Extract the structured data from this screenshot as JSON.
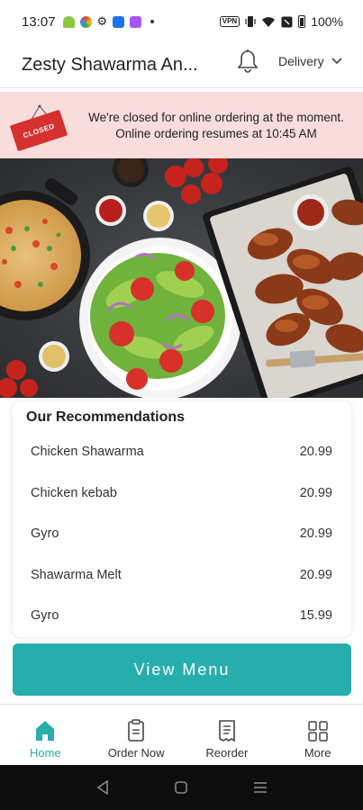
{
  "status_bar": {
    "time": "13:07",
    "vpn": "VPN",
    "battery": "100%"
  },
  "header": {
    "store_name": "Zesty Shawarma An...",
    "delivery_label": "Delivery",
    "icons": [
      "bell-icon",
      "chevron-down-icon"
    ]
  },
  "banner": {
    "sign_text": "CLOSED",
    "line1": "We're closed for online ordering at the moment.",
    "line2": "Online ordering resumes at 10:45 AM"
  },
  "recommendations": {
    "title": "Our Recommendations",
    "items": [
      {
        "name": "Chicken Shawarma",
        "price": "20.99"
      },
      {
        "name": "Chicken kebab",
        "price": "20.99"
      },
      {
        "name": "Gyro",
        "price": "20.99"
      },
      {
        "name": "Shawarma Melt",
        "price": "20.99"
      },
      {
        "name": "Gyro",
        "price": "15.99"
      }
    ]
  },
  "view_menu": {
    "label": "View Menu"
  },
  "bottom_nav": {
    "items": [
      {
        "label": "Home",
        "icon": "home-icon",
        "active": true
      },
      {
        "label": "Order Now",
        "icon": "clipboard-icon",
        "active": false
      },
      {
        "label": "Reorder",
        "icon": "receipt-icon",
        "active": false
      },
      {
        "label": "More",
        "icon": "grid-icon",
        "active": false
      }
    ]
  },
  "colors": {
    "accent": "#26aeac",
    "banner_bg": "#f9dcdc",
    "closed_sign": "#d6312f"
  }
}
